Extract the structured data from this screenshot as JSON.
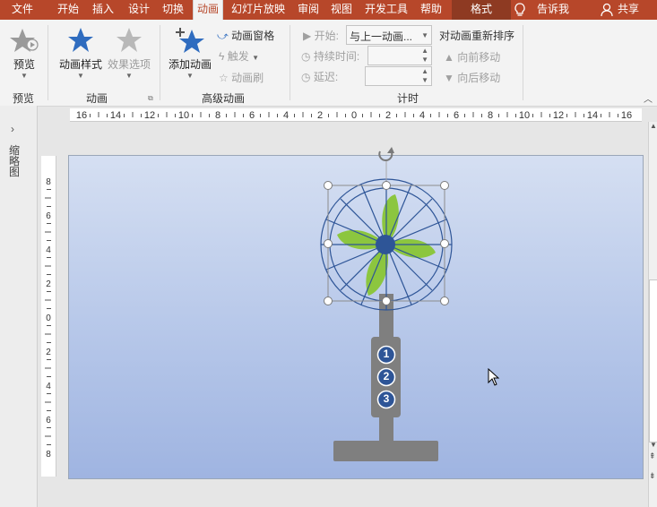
{
  "tabs": [
    {
      "label": "文件"
    },
    {
      "label": "开始"
    },
    {
      "label": "插入"
    },
    {
      "label": "设计"
    },
    {
      "label": "切换"
    },
    {
      "label": "动画"
    },
    {
      "label": "幻灯片放映"
    },
    {
      "label": "审阅"
    },
    {
      "label": "视图"
    },
    {
      "label": "开发工具"
    },
    {
      "label": "帮助"
    },
    {
      "label": "格式"
    }
  ],
  "tell_me": "告诉我",
  "share": "共享",
  "groups": {
    "preview": {
      "button": "预览",
      "label": "预览"
    },
    "animation": {
      "styles": "动画样式",
      "effects": "效果选项",
      "label": "动画"
    },
    "advanced": {
      "add": "添加动画",
      "pane": "动画窗格",
      "trigger": "触发",
      "painter": "动画刷",
      "label": "高级动画"
    },
    "timing": {
      "start_label": "开始:",
      "start_value": "与上一动画...",
      "duration_label": "持续时间:",
      "delay_label": "延迟:",
      "reorder": "对动画重新排序",
      "move_earlier": "向前移动",
      "move_later": "向后移动",
      "label": "计时"
    }
  },
  "left_pane": {
    "label": "缩略图"
  },
  "rulers": {
    "horizontal": [
      "16",
      "14",
      "12",
      "10",
      "8",
      "6",
      "4",
      "2",
      "0",
      "2",
      "4",
      "6",
      "8",
      "10",
      "12",
      "14",
      "16"
    ],
    "vertical": [
      "8",
      "6",
      "4",
      "2",
      "0",
      "2",
      "4",
      "6",
      "8"
    ]
  },
  "fan": {
    "buttons": [
      "1",
      "2",
      "3"
    ]
  }
}
